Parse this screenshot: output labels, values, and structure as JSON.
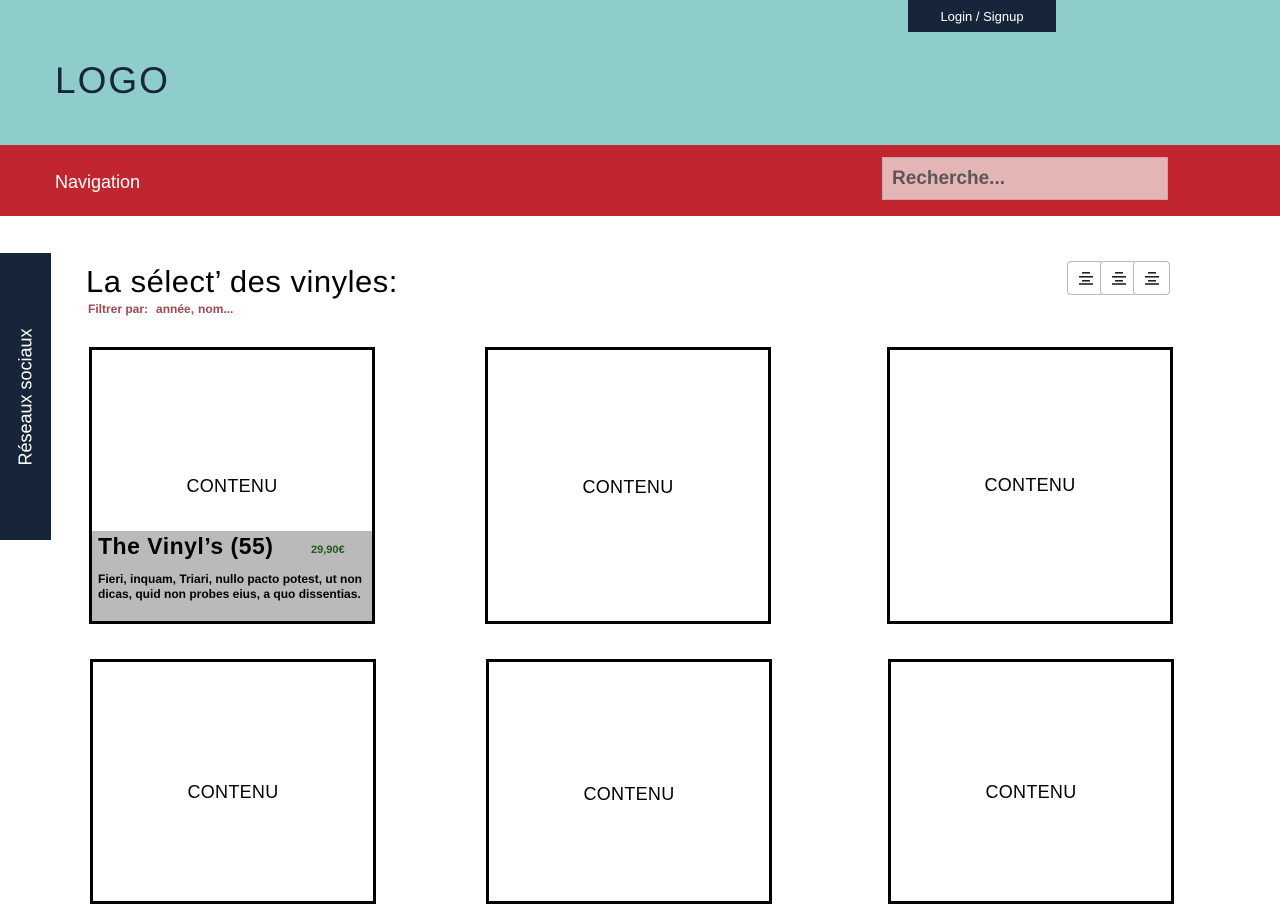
{
  "header": {
    "logo": "LOGO",
    "login_label": "Login / Signup"
  },
  "nav": {
    "label": "Navigation",
    "search_placeholder": "Recherche..."
  },
  "sidebar": {
    "social_label": "Réseaux sociaux"
  },
  "main": {
    "title": "La sélect’ des vinyles:",
    "filter_label": "Filtrer par:",
    "filter_options": [
      "année,",
      "nom..."
    ],
    "view_buttons": [
      "align-center-icon",
      "align-center-icon",
      "align-center-icon"
    ]
  },
  "cards": [
    {
      "content": "CONTENU",
      "title": "The Vinyl’s (55)",
      "price": "29,90€",
      "description": "Fieri, inquam, Triari, nullo pacto potest, ut non dicas, quid non probes eius, a quo dissentias."
    },
    {
      "content": "CONTENU"
    },
    {
      "content": "CONTENU"
    },
    {
      "content": "CONTENU"
    },
    {
      "content": "CONTENU"
    },
    {
      "content": "CONTENU"
    }
  ],
  "colors": {
    "header_bg": "#8fcdcb",
    "nav_bg": "#c1252e",
    "dark": "#17253a",
    "price": "#1d5a1d",
    "filter": "#a3484e"
  }
}
